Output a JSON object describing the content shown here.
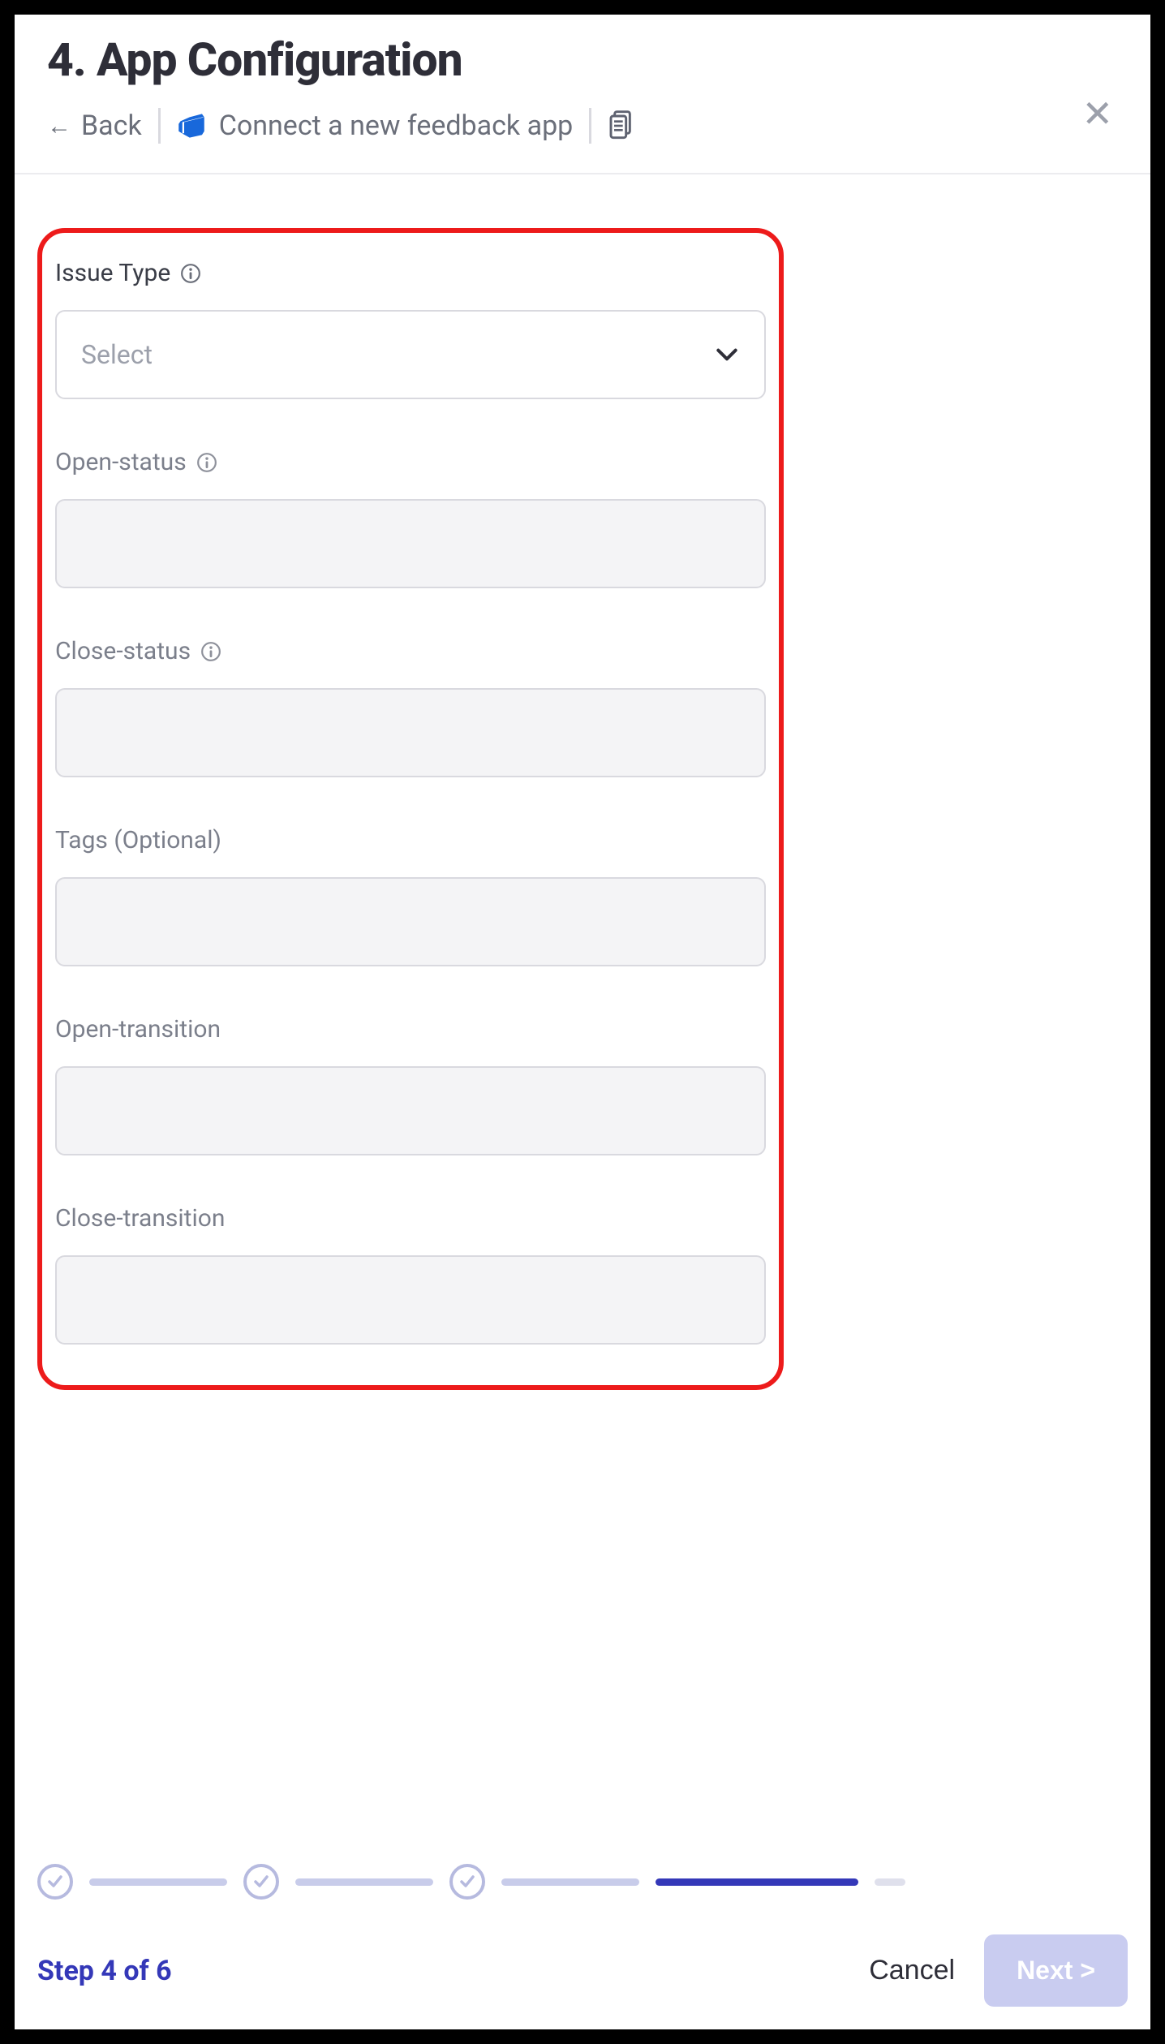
{
  "header": {
    "title": "4. App Configuration",
    "back_label": "Back",
    "connect_label": "Connect a new feedback app"
  },
  "form": {
    "issue_type": {
      "label": "Issue Type",
      "placeholder": "Select"
    },
    "open_status": {
      "label": "Open-status"
    },
    "close_status": {
      "label": "Close-status"
    },
    "tags": {
      "label": "Tags (Optional)"
    },
    "open_transition": {
      "label": "Open-transition"
    },
    "close_transition": {
      "label": "Close-transition"
    }
  },
  "footer": {
    "step_label": "Step 4 of 6",
    "cancel_label": "Cancel",
    "next_label": "Next >"
  }
}
